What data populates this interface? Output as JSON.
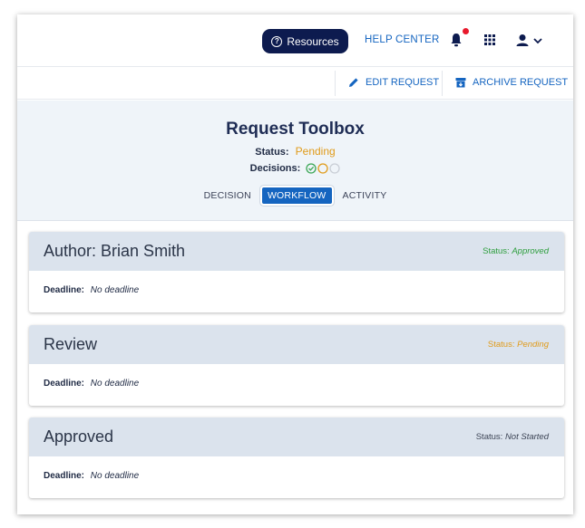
{
  "topnav": {
    "resources_label": "Resources",
    "help_label": "HELP CENTER",
    "notification_badge_color": "#e8192c"
  },
  "actions": {
    "edit_label": "EDIT REQUEST",
    "archive_label": "ARCHIVE REQUEST"
  },
  "toolbox": {
    "title": "Request Toolbox",
    "status_label": "Status:",
    "status_value": "Pending",
    "decisions_label": "Decisions:",
    "decisions": [
      {
        "state": "approved",
        "color": "#3aa655"
      },
      {
        "state": "pending",
        "color": "#e09b1a"
      },
      {
        "state": "not-started",
        "color": "#c9ced6"
      }
    ],
    "tabs": [
      {
        "label": "DECISION",
        "active": false
      },
      {
        "label": "WORKFLOW",
        "active": true
      },
      {
        "label": "ACTIVITY",
        "active": false
      }
    ]
  },
  "workflow": {
    "steps": [
      {
        "title": "Author: Brian Smith",
        "status_label": "Status:",
        "status_value": "Approved",
        "status_color": "#2e9e3e",
        "deadline_label": "Deadline:",
        "deadline_value": "No deadline"
      },
      {
        "title": "Review",
        "status_label": "Status:",
        "status_value": "Pending",
        "status_color": "#e09b1a",
        "deadline_label": "Deadline:",
        "deadline_value": "No deadline"
      },
      {
        "title": "Approved",
        "status_label": "Status:",
        "status_value": "Not Started",
        "status_color": "#3d4556",
        "deadline_label": "Deadline:",
        "deadline_value": "No deadline"
      }
    ]
  },
  "colors": {
    "brand_navy": "#0d1b4f",
    "link_blue": "#1565c0",
    "pending": "#e09b1a",
    "approved": "#2e9e3e"
  }
}
